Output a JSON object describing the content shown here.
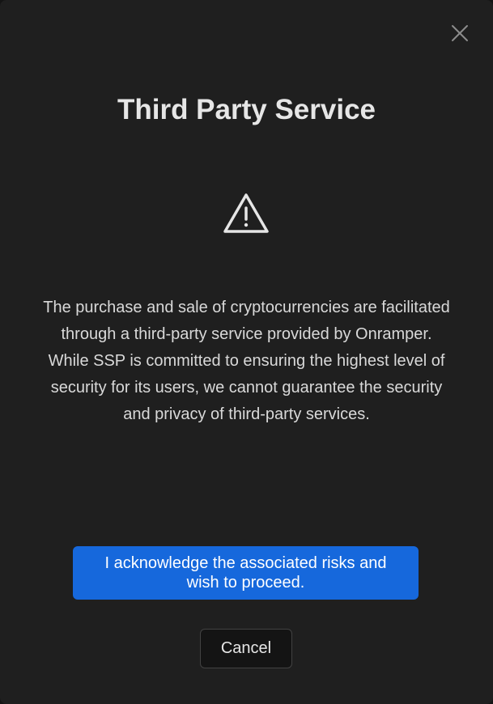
{
  "modal": {
    "title": "Third Party Service",
    "icons": {
      "close": "close-icon",
      "warning": "warning-triangle-icon"
    },
    "message_lines": [
      "The purchase and sale of cryptocurrencies are facilitated",
      "through a third-party service provided by Onramper.",
      "While SSP is committed to ensuring the highest level of",
      "security for its users, we cannot guarantee the security",
      "and privacy of third-party services."
    ],
    "primary_button_lines": [
      "I acknowledge the associated risks and",
      "wish to proceed."
    ],
    "cancel_label": "Cancel"
  },
  "colors": {
    "background": "#1f1f1f",
    "primary": "#1668dc",
    "text": "#e6e6e6"
  }
}
